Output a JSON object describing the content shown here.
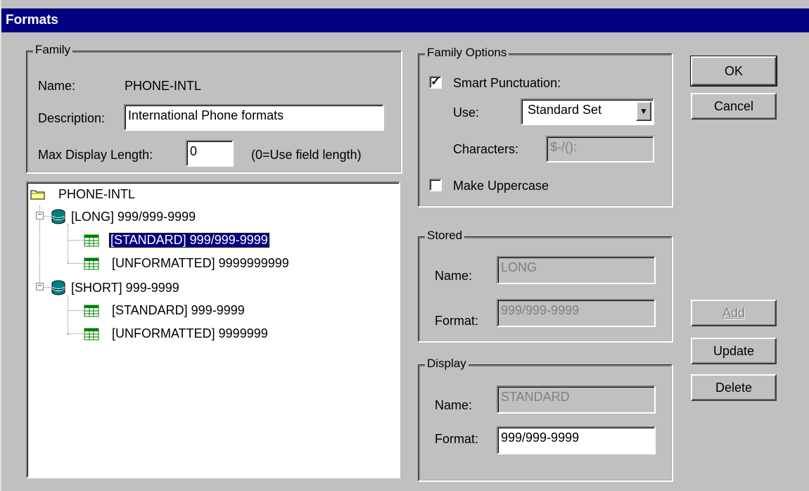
{
  "window": {
    "title": "Formats"
  },
  "family": {
    "group_label": "Family",
    "name_label": "Name:",
    "name_value": "PHONE-INTL",
    "description_label": "Description:",
    "description_value": "International Phone formats",
    "max_length_label": "Max Display Length:",
    "max_length_value": "0",
    "max_length_hint": "(0=Use field length)"
  },
  "tree": {
    "root": {
      "label": "PHONE-INTL",
      "icon": "folder-icon"
    },
    "groups": [
      {
        "label": "[LONG] 999/999-9999",
        "icon": "database-icon",
        "children": [
          {
            "label": "[STANDARD] 999/999-9999",
            "selected": true,
            "icon": "grid-icon"
          },
          {
            "label": "[UNFORMATTED] 9999999999",
            "selected": false,
            "icon": "grid-icon"
          }
        ]
      },
      {
        "label": "[SHORT] 999-9999",
        "icon": "database-icon",
        "children": [
          {
            "label": "[STANDARD] 999-9999",
            "selected": false,
            "icon": "grid-icon"
          },
          {
            "label": "[UNFORMATTED] 9999999",
            "selected": false,
            "icon": "grid-icon"
          }
        ]
      }
    ]
  },
  "family_options": {
    "group_label": "Family Options",
    "smart_punctuation_label": "Smart Punctuation:",
    "smart_punctuation_checked": true,
    "use_label": "Use:",
    "use_value": "Standard Set",
    "characters_label": "Characters:",
    "characters_value": "$-/():",
    "make_uppercase_label": "Make Uppercase",
    "make_uppercase_checked": false
  },
  "stored": {
    "group_label": "Stored",
    "name_label": "Name:",
    "name_value": "LONG",
    "format_label": "Format:",
    "format_value": "999/999-9999"
  },
  "display": {
    "group_label": "Display",
    "name_label": "Name:",
    "name_value": "STANDARD",
    "format_label": "Format:",
    "format_value": "999/999-9999"
  },
  "buttons": {
    "ok": "OK",
    "cancel": "Cancel",
    "add": "Add",
    "update": "Update",
    "delete": "Delete"
  },
  "colors": {
    "title_bar": "#000080",
    "dialog_bg": "#c0c0c0",
    "selection": "#000080"
  }
}
